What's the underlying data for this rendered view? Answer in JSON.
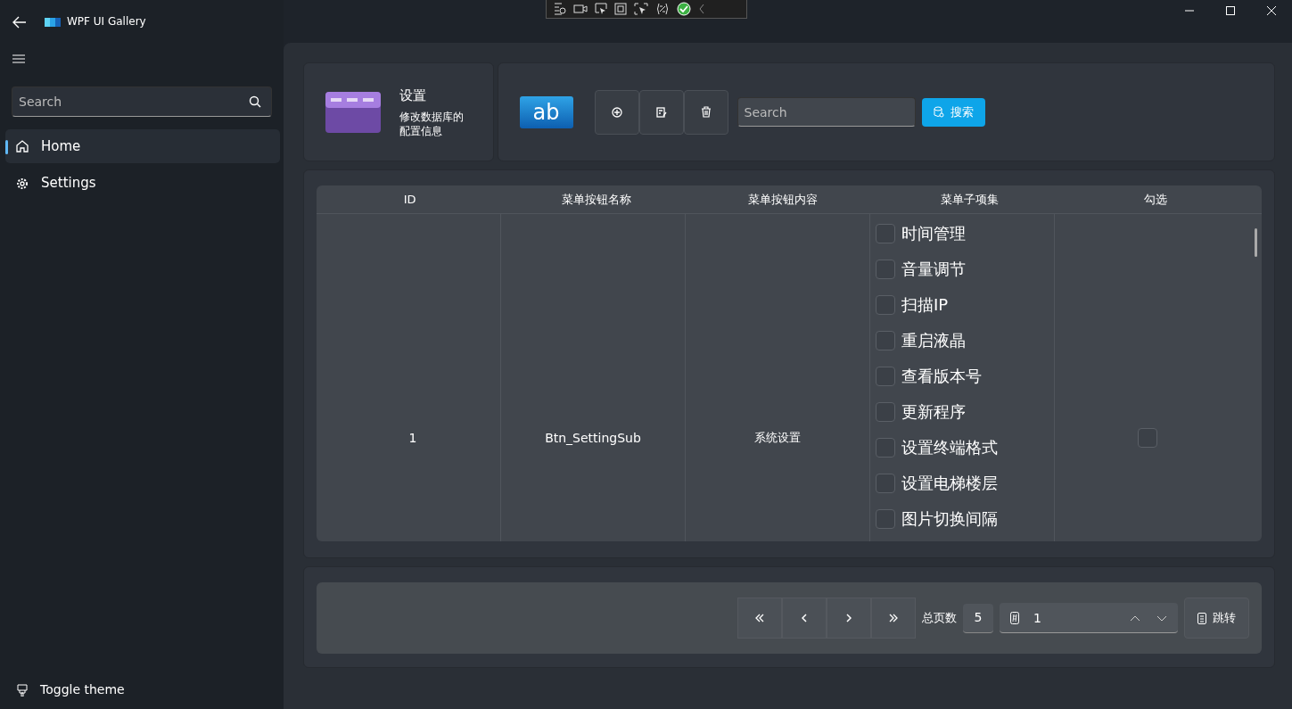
{
  "window": {
    "title": "WPF UI Gallery"
  },
  "sidebar": {
    "search": {
      "placeholder": "Search"
    },
    "items": [
      {
        "label": "Home",
        "selected": true
      },
      {
        "label": "Settings",
        "selected": false
      }
    ],
    "footer": {
      "label": "Toggle theme"
    }
  },
  "header_card": {
    "title": "设置",
    "description": "修改数据库的配置信息"
  },
  "toolbar": {
    "logo": "ab",
    "search": {
      "placeholder": "Search"
    },
    "search_button": "搜索"
  },
  "table": {
    "columns": [
      "ID",
      "菜单按钮名称",
      "菜单按钮内容",
      "菜单子项集",
      "勾选"
    ],
    "rows": [
      {
        "id": "1",
        "name": "Btn_SettingSub",
        "content": "系统设置",
        "checked": false,
        "sub_items": [
          {
            "label": "时间管理",
            "checked": false
          },
          {
            "label": "音量调节",
            "checked": false
          },
          {
            "label": "扫描IP",
            "checked": false
          },
          {
            "label": "重启液晶",
            "checked": false
          },
          {
            "label": "查看版本号",
            "checked": false
          },
          {
            "label": "更新程序",
            "checked": false
          },
          {
            "label": "设置终端格式",
            "checked": false
          },
          {
            "label": "设置电梯楼层",
            "checked": false
          },
          {
            "label": "图片切换间隔",
            "checked": false
          }
        ]
      }
    ]
  },
  "pagination": {
    "total_label": "总页数",
    "total": "5",
    "page": "1",
    "jump_button": "跳转"
  }
}
